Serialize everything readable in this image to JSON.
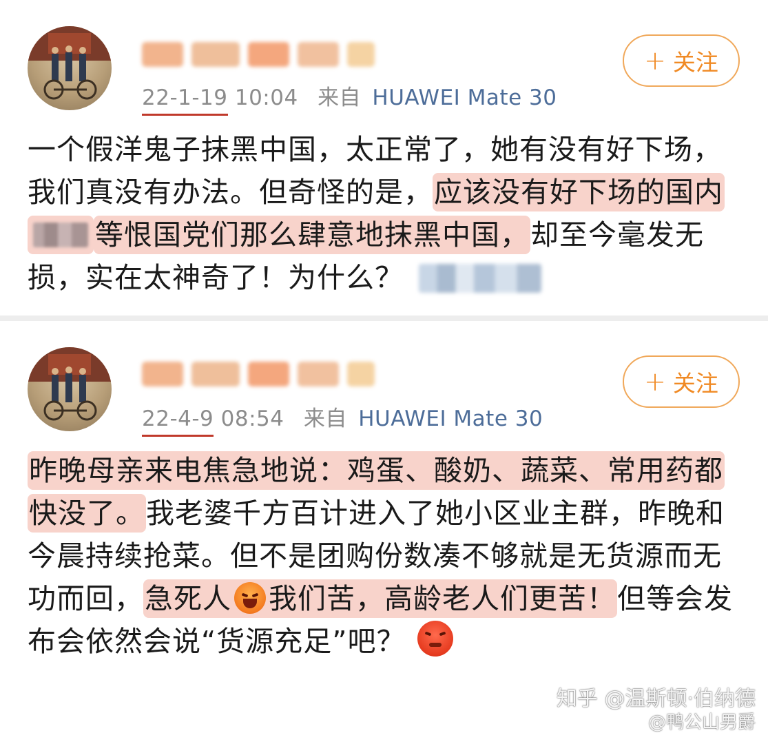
{
  "posts": [
    {
      "date": "22-1-19",
      "time": "10:04",
      "source_prefix": "来自",
      "device": "HUAWEI Mate 30",
      "follow_label": "关注",
      "follow_plus": "+",
      "text": {
        "p1": "一个假洋鬼子抹黑中国，太正常了，她有没有好下场，我们真没有办法。但奇怪的是，",
        "hl1": "应该没有好下场的国内",
        "hl2": "等恨国党们那么肆意地抹黑中国，",
        "p2": "却至今毫发无损，实在太神奇了！为什么？"
      }
    },
    {
      "date": "22-4-9",
      "time": "08:54",
      "source_prefix": "来自",
      "device": "HUAWEI Mate 30",
      "follow_label": "关注",
      "follow_plus": "+",
      "text": {
        "hl1": "昨晚母亲来电焦急地说：鸡蛋、酸奶、蔬菜、常用药都快没了。",
        "p1": "我老婆千方百计进入了她小区业主群，昨晚和今晨持续抢菜。但不是团购份数凑不够就是无货源而无功而回，",
        "hl2a": "急死人",
        "hl2b": "我们苦，高龄老人们更苦！",
        "p2": "但等会发布会依然会说“货源充足”吧？"
      }
    }
  ],
  "watermark": {
    "line1": "知乎 @温斯顿·伯纳德",
    "line2": "@鸭公山男爵"
  },
  "icons": {
    "emoji1": "crying-face-icon",
    "emoji2": "angry-face-icon"
  },
  "colors": {
    "highlight": "#f8d3cb",
    "follow_orange": "#f08a24",
    "device_blue": "#4d6d99",
    "date_underline": "#c0392b"
  }
}
